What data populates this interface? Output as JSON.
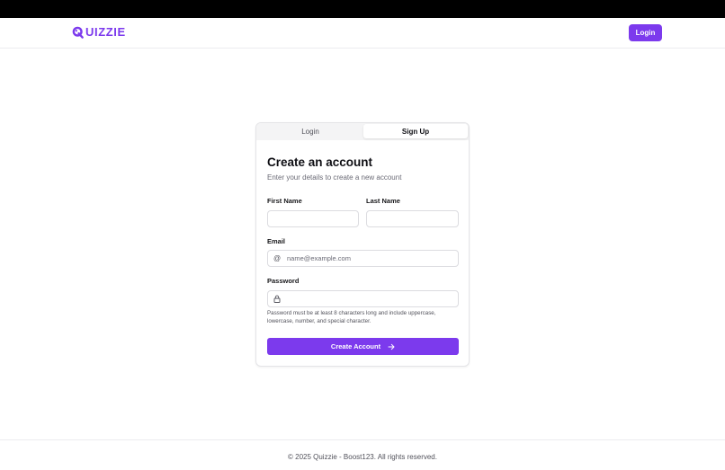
{
  "brand": {
    "name": "UIZZIE",
    "color": "#7c3aed",
    "icon": "q-logo-icon"
  },
  "header": {
    "login_label": "Login"
  },
  "tabs": [
    {
      "label": "Login",
      "active": false
    },
    {
      "label": "Sign Up",
      "active": true
    }
  ],
  "form": {
    "title": "Create an account",
    "subtitle": "Enter your details to create a new account",
    "first_name": {
      "label": "First Name",
      "value": "",
      "placeholder": ""
    },
    "last_name": {
      "label": "Last Name",
      "value": "",
      "placeholder": ""
    },
    "email": {
      "label": "Email",
      "value": "",
      "placeholder": "name@example.com",
      "icon": "at-icon"
    },
    "password": {
      "label": "Password",
      "value": "",
      "placeholder": "",
      "icon": "lock-icon"
    },
    "password_hint": "Password must be at least 8 characters long and include uppercase, lowercase, number, and special character.",
    "submit_label": "Create Account",
    "submit_icon": "arrow-right-icon"
  },
  "footer": {
    "text": "© 2025 Quizzie - Boost123. All rights reserved."
  }
}
